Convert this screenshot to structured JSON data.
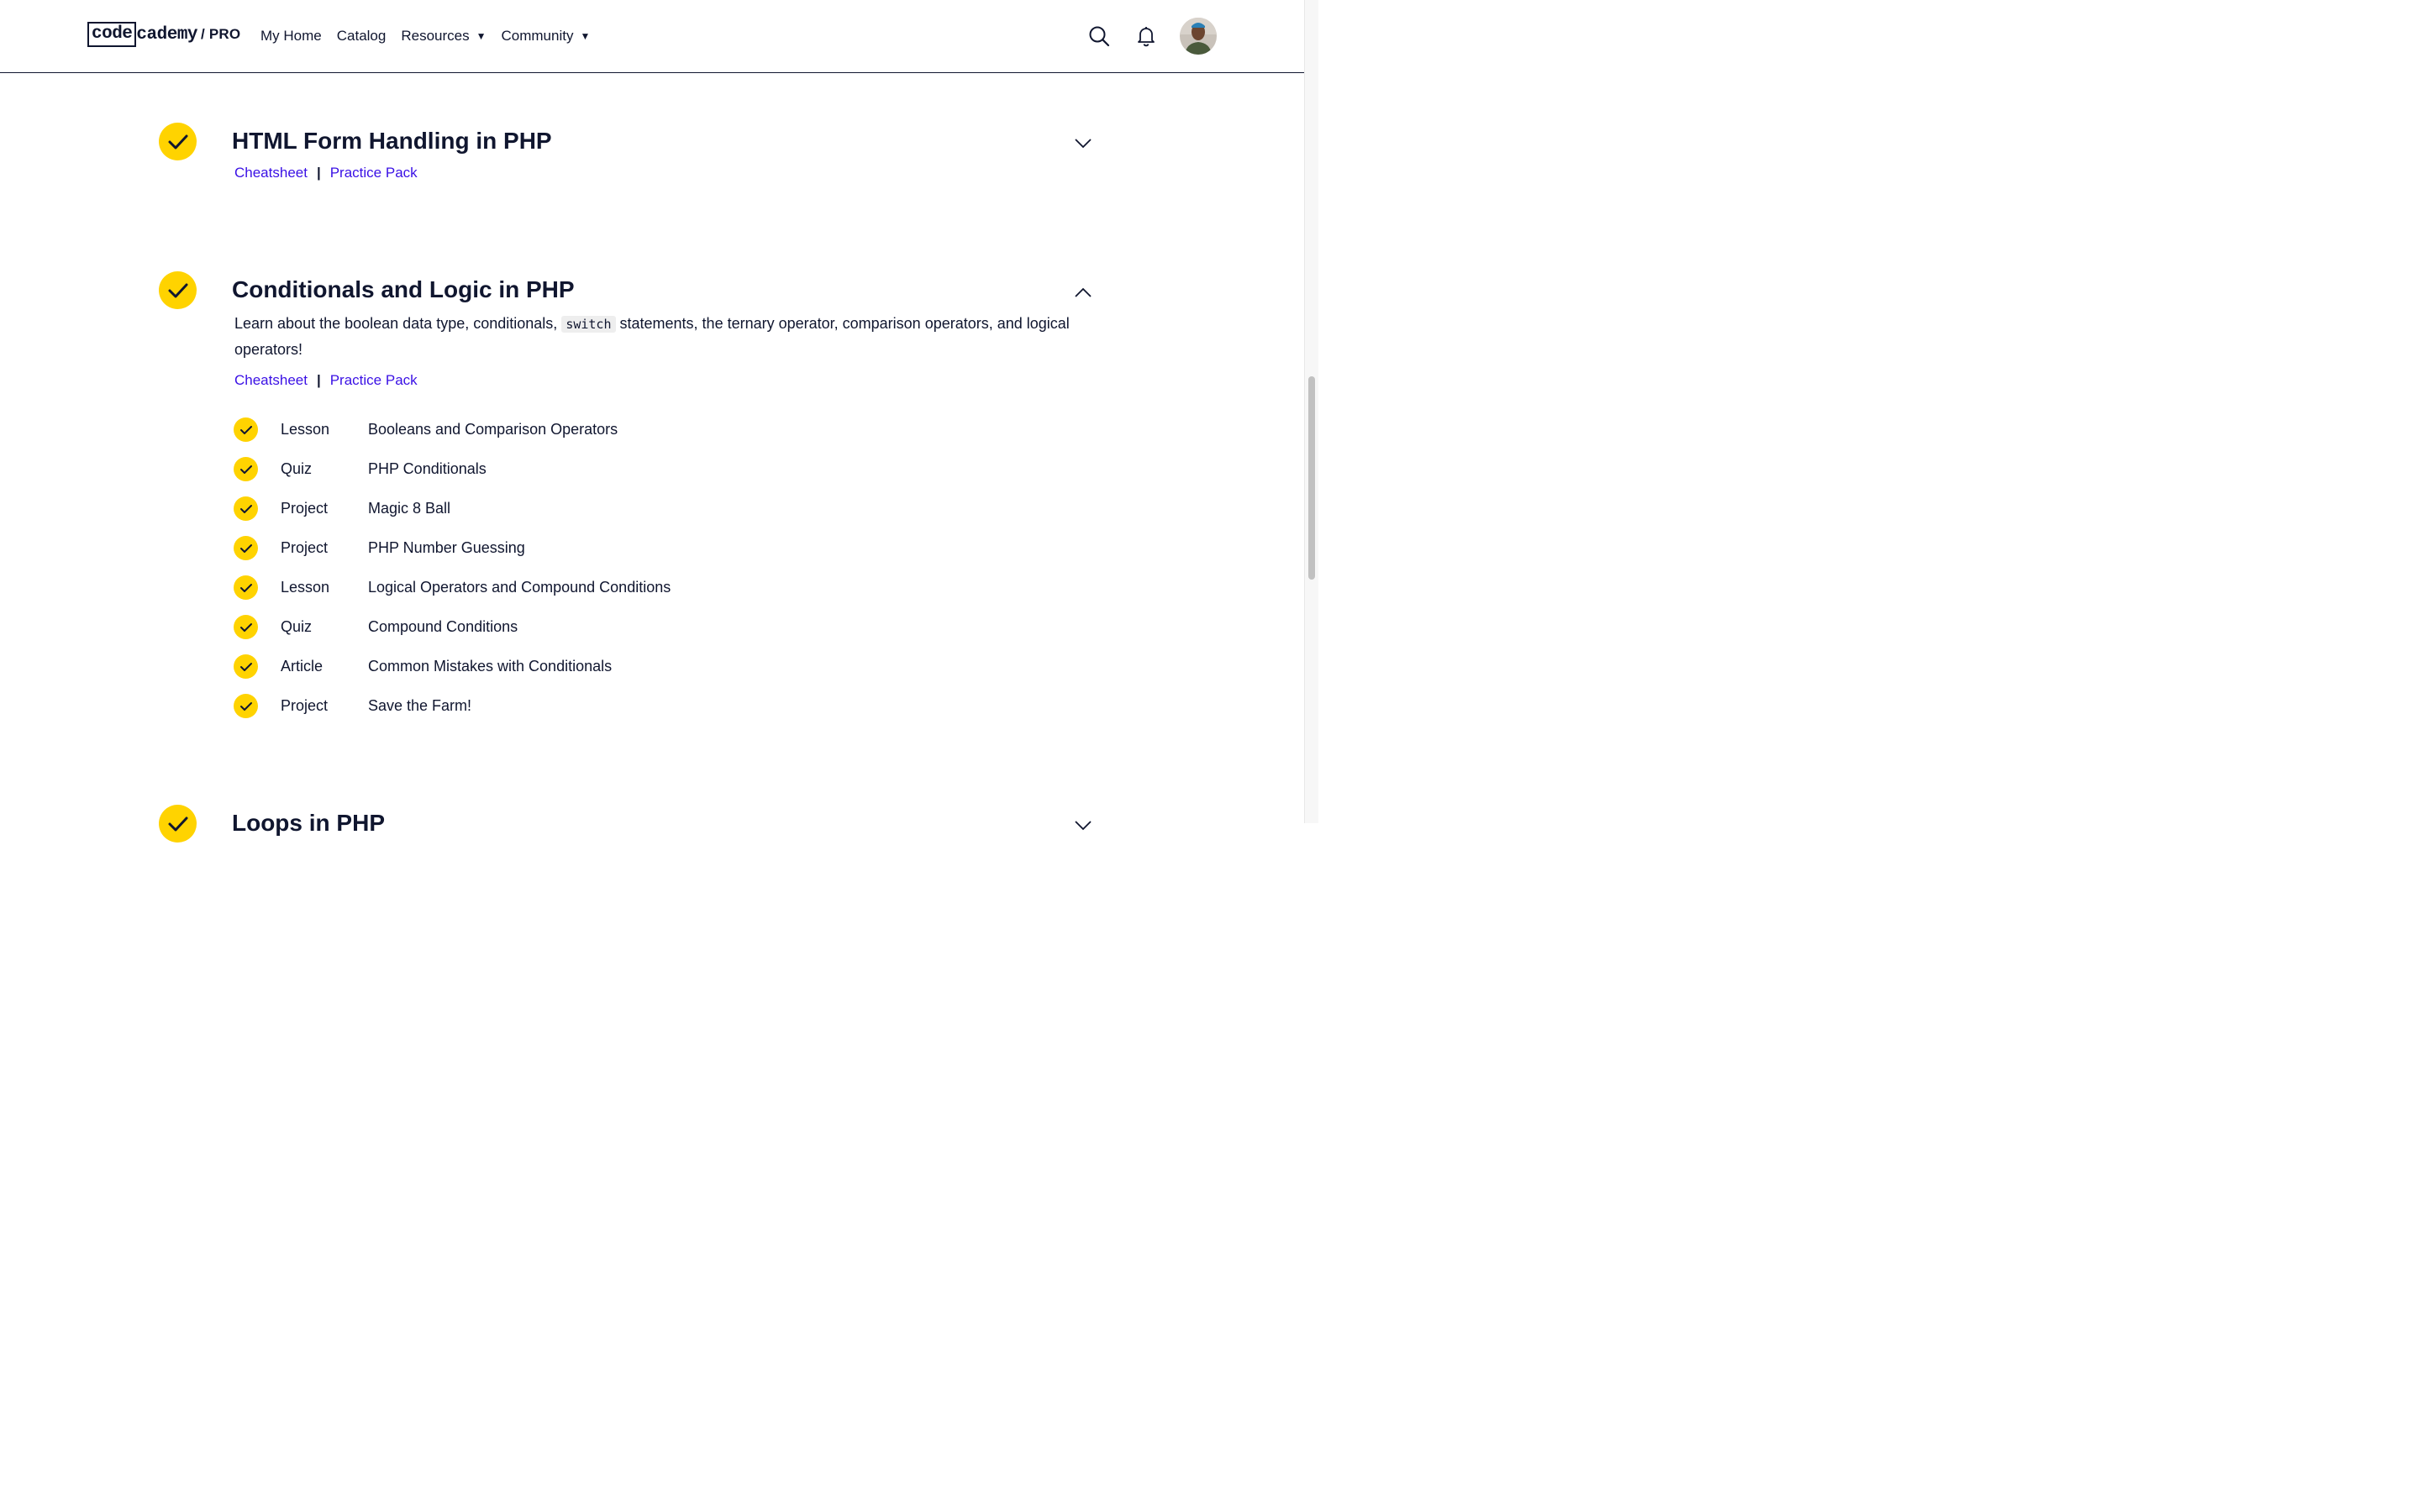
{
  "header": {
    "logo": {
      "code": "code",
      "cademy": "cademy",
      "pro": "/ PRO"
    },
    "nav": [
      {
        "label": "My Home"
      },
      {
        "label": "Catalog"
      },
      {
        "label": "Resources",
        "caret": "▼"
      },
      {
        "label": "Community",
        "caret": "▼"
      }
    ],
    "icons": [
      "search-icon",
      "bell-icon"
    ]
  },
  "modules": [
    {
      "title": "HTML Form Handling in PHP",
      "expanded": false,
      "links": {
        "cheatsheet": "Cheatsheet",
        "separator": "|",
        "practice": "Practice Pack"
      }
    },
    {
      "title": "Conditionals and Logic in PHP",
      "expanded": true,
      "description": {
        "before": "Learn about the boolean data type, conditionals,",
        "code": "switch",
        "after": "statements, the ternary operator, comparison operators, and logical operators!"
      },
      "links": {
        "cheatsheet": "Cheatsheet",
        "separator": "|",
        "practice": "Practice Pack"
      },
      "items": [
        {
          "type": "Lesson",
          "name": "Booleans and Comparison Operators"
        },
        {
          "type": "Quiz",
          "name": "PHP Conditionals"
        },
        {
          "type": "Project",
          "name": "Magic 8 Ball"
        },
        {
          "type": "Project",
          "name": "PHP Number Guessing"
        },
        {
          "type": "Lesson",
          "name": "Logical Operators and Compound Conditions"
        },
        {
          "type": "Quiz",
          "name": "Compound Conditions"
        },
        {
          "type": "Article",
          "name": "Common Mistakes with Conditionals"
        },
        {
          "type": "Project",
          "name": "Save the Farm!"
        }
      ]
    },
    {
      "title": "Loops in PHP",
      "expanded": false
    }
  ],
  "colors": {
    "accent": "#ffd300",
    "link": "#3a10e5",
    "text": "#10162f"
  }
}
